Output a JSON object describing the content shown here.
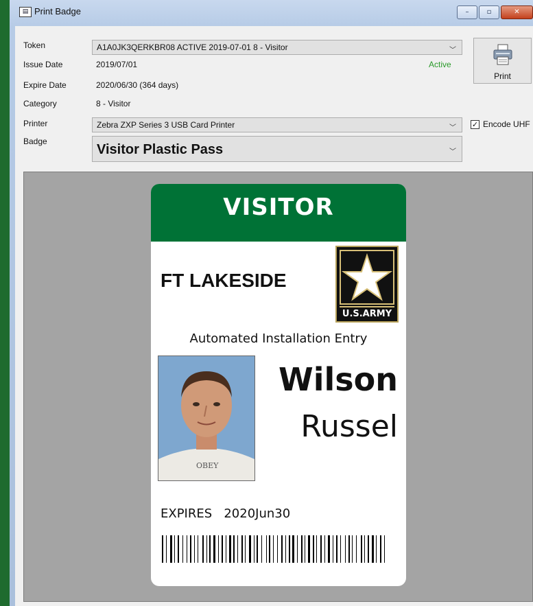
{
  "window": {
    "title": "Print Badge",
    "app_icon_glyph": "▤",
    "controls": {
      "minimize": "–",
      "maximize": "▫",
      "close": "✕"
    }
  },
  "form": {
    "token": {
      "label": "Token",
      "value": "A1A0JK3QERKBR08  ACTIVE  2019-07-01  8 - Visitor"
    },
    "issue_date": {
      "label": "Issue Date",
      "value": "2019/07/01"
    },
    "status": {
      "text": "Active",
      "color": "#2a9a2a"
    },
    "expire_date": {
      "label": "Expire Date",
      "value": "2020/06/30  (364 days)"
    },
    "category": {
      "label": "Category",
      "value": "8 - Visitor"
    },
    "printer": {
      "label": "Printer",
      "value": "Zebra ZXP Series 3 USB Card Printer"
    },
    "badge": {
      "label": "Badge",
      "value": "Visitor Plastic Pass"
    },
    "encode_uhf": {
      "label": "Encode UHF",
      "checked": true
    },
    "print_button": {
      "label": "Print",
      "icon": "printer-icon"
    },
    "dropdown_arrow": "﹀"
  },
  "badge_preview": {
    "header": "VISITOR",
    "header_color": "#007236",
    "installation": "FT LAKESIDE",
    "logo_text": "U.S.ARMY",
    "subtitle": "Automated Installation Entry",
    "last_name": "Wilson",
    "first_name": "Russel",
    "photo_shirt_text": "OBEY",
    "expires_label": "EXPIRES",
    "expires_value": "2020Jun30"
  }
}
